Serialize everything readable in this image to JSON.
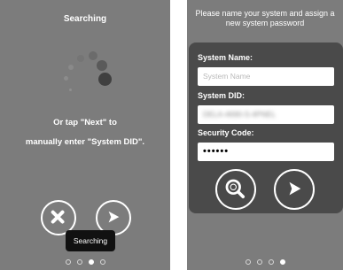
{
  "left_screen": {
    "title": "Searching",
    "instruction_line1": "Or tap \"Next\" to",
    "instruction_line2": "manually enter \"System DID\".",
    "tooltip": "Searching",
    "buttons": {
      "cancel_icon": "close-icon",
      "next_icon": "play-arrow-icon"
    },
    "pager": {
      "pages": 4,
      "active_index": 2
    }
  },
  "right_screen": {
    "title": "Please name your system and assign a new system password",
    "form": {
      "system_name_label": "System Name:",
      "system_name_placeholder": "System Name",
      "system_did_label": "System DID:",
      "system_did_value": "DELA-4690-S-4PNEL",
      "security_code_label": "Security Code:",
      "security_code_value": "••••••"
    },
    "buttons": {
      "search_icon": "search-icon",
      "next_icon": "play-arrow-icon"
    },
    "pager": {
      "pages": 4,
      "active_index": 3
    }
  },
  "colors": {
    "screen_bg": "#7c7c7c",
    "panel_bg": "#4a4a4a",
    "tooltip_bg": "#111111"
  }
}
